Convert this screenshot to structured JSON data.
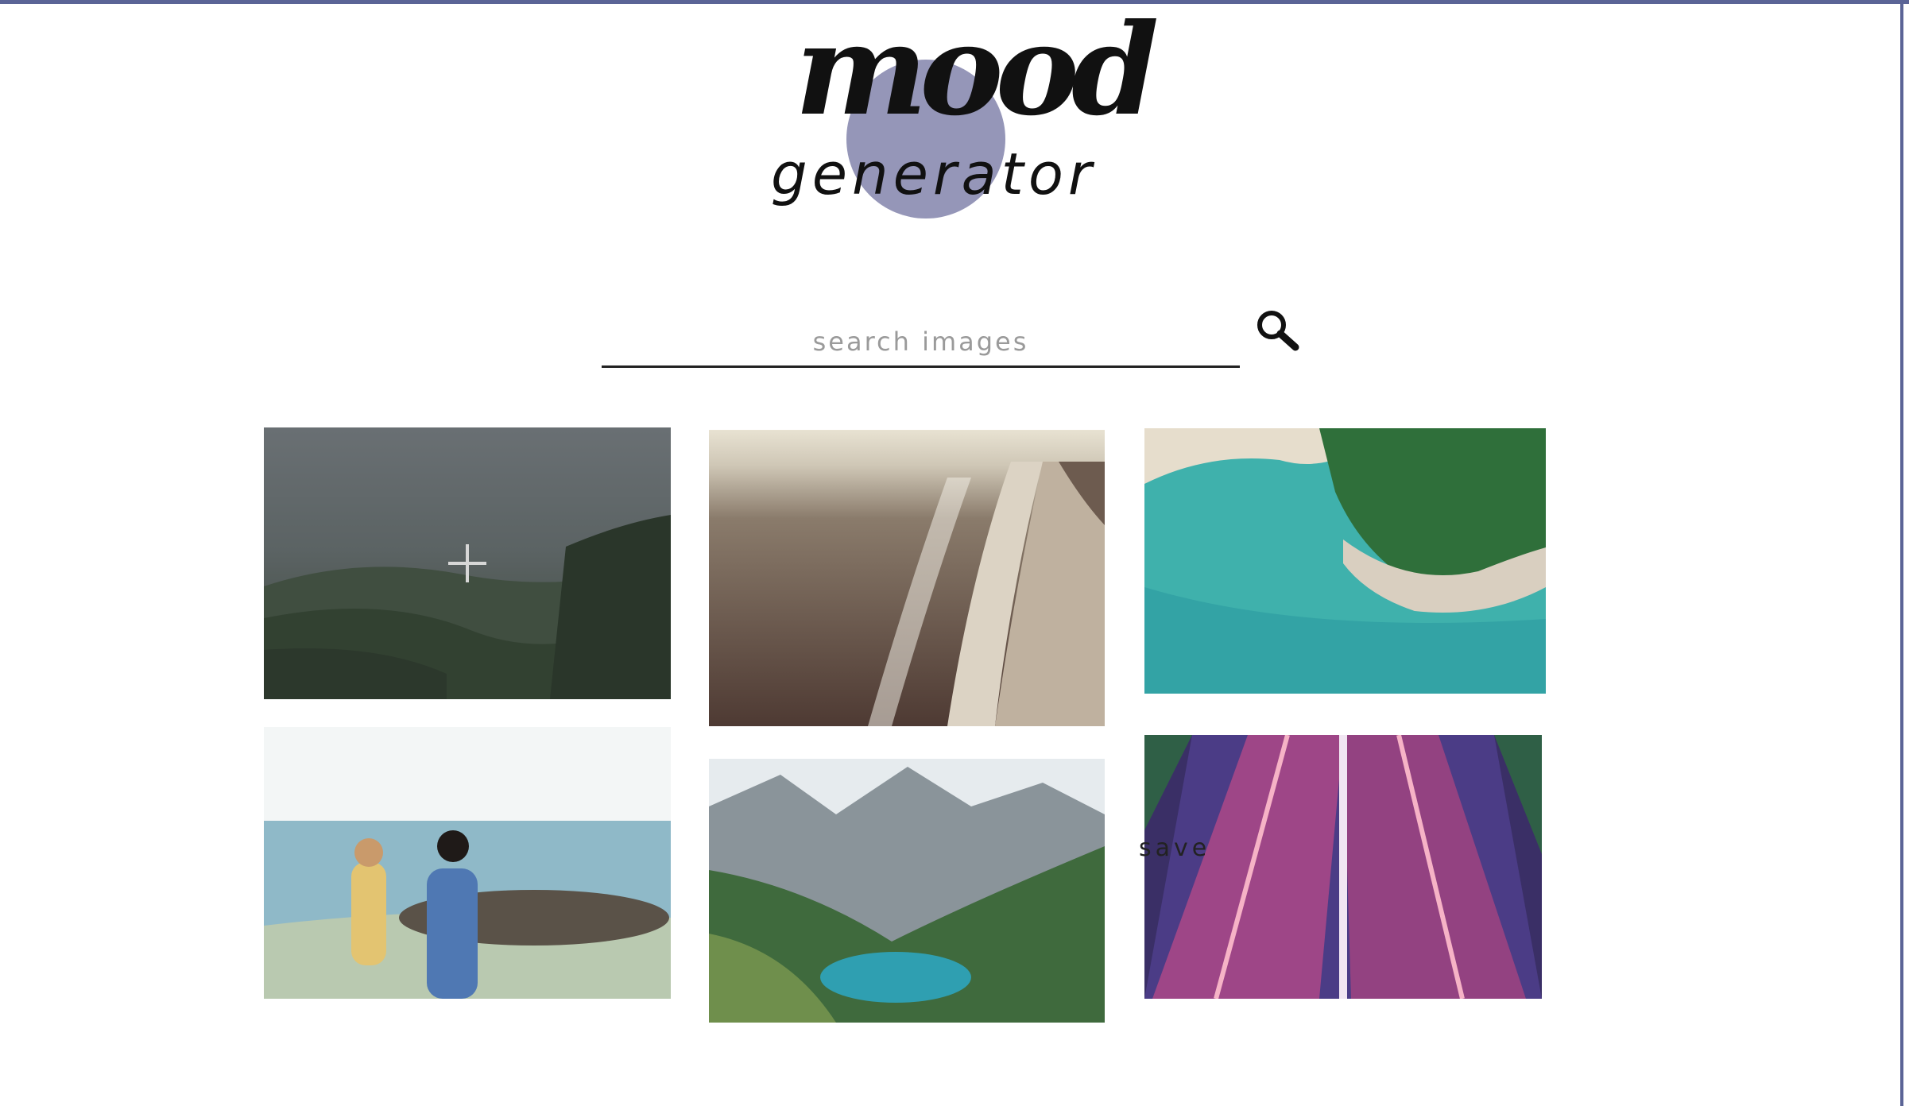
{
  "logo": {
    "word_top": "mood",
    "word_bottom": "generator"
  },
  "search": {
    "placeholder": "search images",
    "value": ""
  },
  "icons": {
    "search": "magnifier-icon",
    "add": "plus-icon"
  },
  "colors": {
    "accent": "#9596b8",
    "frame": "#5b6496",
    "overlay": "rgba(40,42,46,0.55)"
  },
  "images": [
    {
      "name": "forest-valley",
      "state": "hover-add"
    },
    {
      "name": "beach-waves"
    },
    {
      "name": "aerial-lagoon"
    },
    {
      "name": "friends-on-shore"
    },
    {
      "name": "mountain-lake"
    },
    {
      "name": "highway-light-trails",
      "label": "save"
    }
  ]
}
